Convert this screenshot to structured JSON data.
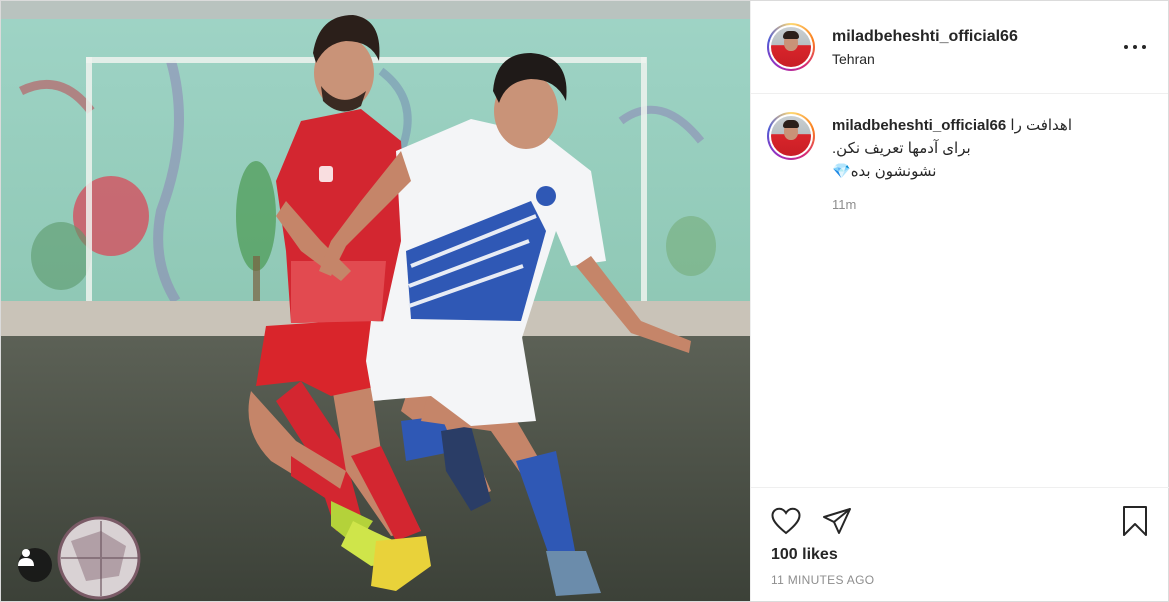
{
  "post": {
    "username": "miladbeheshti_official66",
    "location": "Tehran",
    "caption": {
      "line1": "اهدافت را",
      "line2": "برای آدمها تعریف نکن.",
      "line3": "نشونشون بده",
      "emoji": "💎"
    },
    "comment_time": "11m",
    "likes": "100 likes",
    "timestamp": "11 MINUTES AGO"
  },
  "icons": {
    "more": "more-options-icon",
    "like": "heart-icon",
    "share": "send-icon",
    "save": "bookmark-icon",
    "tags": "user-tag-icon"
  },
  "colors": {
    "jersey_red": "#d32630",
    "jersey_blue": "#2f58b5",
    "text": "#262626",
    "muted": "#8e8e8e",
    "border": "#dbdbdb"
  }
}
